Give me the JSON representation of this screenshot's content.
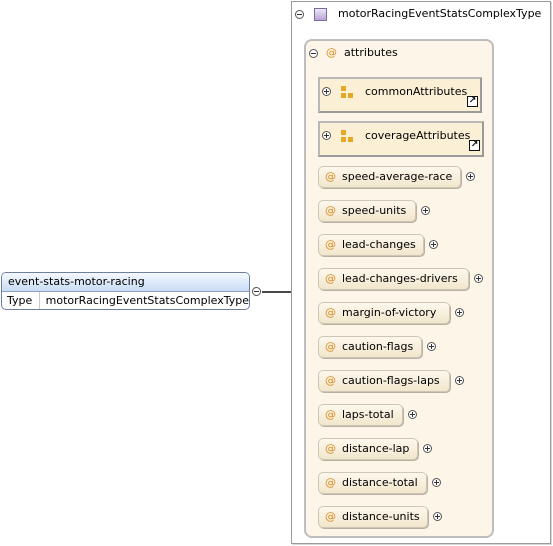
{
  "element": {
    "name": "event-stats-motor-racing",
    "type_key": "Type",
    "type_value": "motorRacingEventStatsComplexType"
  },
  "complex_type": {
    "name": "motorRacingEventStatsComplexType",
    "attributes_label": "attributes",
    "attribute_symbol": "@",
    "attribute_groups": [
      {
        "name": "commonAttributes",
        "icon": "attribute-group-icon"
      },
      {
        "name": "coverageAttributes",
        "icon": "attribute-group-icon"
      }
    ],
    "attributes": [
      "speed-average-race",
      "speed-units",
      "lead-changes",
      "lead-changes-drivers",
      "margin-of-victory",
      "caution-flags",
      "caution-flags-laps",
      "laps-total",
      "distance-lap",
      "distance-total",
      "distance-units"
    ]
  },
  "colors": {
    "element_header": "#c8dbf5",
    "attributes_bg": "#fdf6e8",
    "attribute_symbol": "#d98a1b",
    "type_icon": "#b8a4d6"
  }
}
